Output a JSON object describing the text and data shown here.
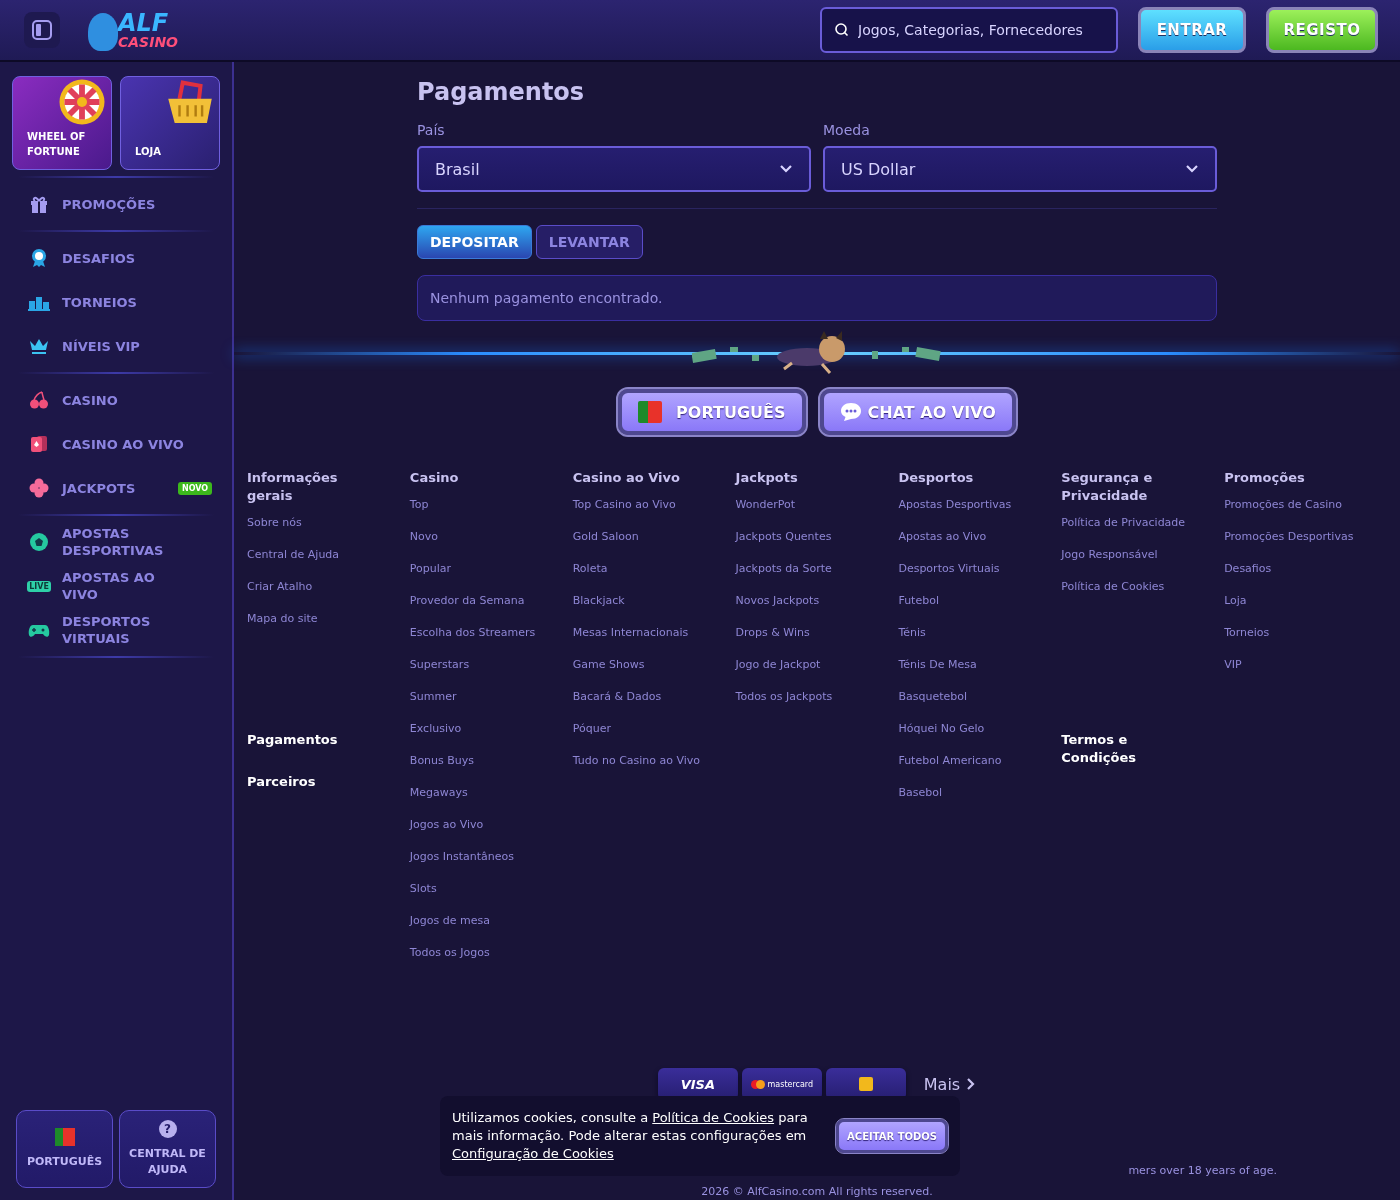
{
  "header": {
    "logo": {
      "line1": "ALF",
      "line2": "CASINO"
    },
    "search": {
      "placeholder": "Jogos, Categorias, Fornecedores"
    },
    "login_button": "ENTRAR",
    "register_button": "REGISTO"
  },
  "sidebar": {
    "promo_cards": [
      {
        "kind": "wheel",
        "label": "WHEEL OF FORTUNE"
      },
      {
        "kind": "basket",
        "label": "LOJA"
      }
    ],
    "groups": [
      [
        {
          "kind": "gift",
          "label": "PROMOÇÕES"
        }
      ],
      [
        {
          "kind": "medal",
          "label": "DESAFIOS"
        },
        {
          "kind": "podium",
          "label": "TORNEIOS"
        },
        {
          "kind": "crown",
          "label": "NÍVEIS VIP"
        }
      ],
      [
        {
          "kind": "cherry",
          "label": "CASINO"
        },
        {
          "kind": "cards",
          "label": "CASINO AO VIVO"
        },
        {
          "kind": "clover",
          "label": "JACKPOTS",
          "badge": "NOVO"
        }
      ],
      [
        {
          "kind": "ball",
          "label": "APOSTAS DESPORTIVAS"
        },
        {
          "kind": "live",
          "label": "APOSTAS AO VIVO",
          "icon_text": "LIVE"
        },
        {
          "kind": "gamepad",
          "label": "DESPORTOS VIRTUAIS"
        }
      ]
    ],
    "bottom_buttons": [
      {
        "kind": "flag",
        "label": "PORTUGUÊS"
      },
      {
        "kind": "help",
        "label": "CENTRAL DE AJUDA",
        "icon_text": "?"
      }
    ]
  },
  "main": {
    "title": "Pagamentos",
    "fields": [
      {
        "label": "País",
        "value": "Brasil"
      },
      {
        "label": "Moeda",
        "value": "US Dollar"
      }
    ],
    "tabs": [
      {
        "label": "DEPOSITAR",
        "selected": true
      },
      {
        "label": "LEVANTAR",
        "selected": false
      }
    ],
    "empty_message": "Nenhum pagamento encontrado."
  },
  "footer": {
    "language_button": "PORTUGUÊS",
    "chat_button": "CHAT AO VIVO",
    "columns": [
      {
        "title": "Informações gerais",
        "links": [
          "Sobre nós",
          "Central de Ajuda",
          "Criar Atalho",
          "Mapa do site"
        ],
        "extra_headings": [
          "Pagamentos",
          "Parceiros"
        ]
      },
      {
        "title": "Casino",
        "links": [
          "Top",
          "Novo",
          "Popular",
          "Provedor da Semana",
          "Escolha dos Streamers",
          "Superstars",
          "Summer",
          "Exclusivo",
          "Bonus Buys",
          "Megaways",
          "Jogos ao Vivo",
          "Jogos Instantâneos",
          "Slots",
          "Jogos de mesa",
          "Todos os Jogos"
        ]
      },
      {
        "title": "Casino ao Vivo",
        "links": [
          "Top Casino ao Vivo",
          "Gold Saloon",
          "Roleta",
          "Blackjack",
          "Mesas Internacionais",
          "Game Shows",
          "Bacará & Dados",
          "Póquer",
          "Tudo no Casino ao Vivo"
        ]
      },
      {
        "title": "Jackpots",
        "links": [
          "WonderPot",
          "Jackpots Quentes",
          "Jackpots da Sorte",
          "Novos Jackpots",
          "Drops & Wins",
          "Jogo de Jackpot",
          "Todos os Jackpots"
        ]
      },
      {
        "title": "Desportos",
        "links": [
          "Apostas Desportivas",
          "Apostas ao Vivo",
          "Desportos Virtuais",
          "Futebol",
          "Ténis",
          "Ténis De Mesa",
          "Basquetebol",
          "Hóquei No Gelo",
          "Futebol Americano",
          "Basebol"
        ]
      },
      {
        "title": "Segurança e Privacidade",
        "links": [
          "Política de Privacidade",
          "Jogo Responsável",
          "Política de Cookies"
        ],
        "extra_headings": [
          "Termos e Condições"
        ]
      },
      {
        "title": "Promoções",
        "links": [
          "Promoções de Casino",
          "Promoções Desportivas",
          "Desafios",
          "Loja",
          "Torneios",
          "VIP"
        ]
      }
    ],
    "payments": [
      {
        "kind": "visa",
        "label": "VISA"
      },
      {
        "kind": "mastercard",
        "label": "mastercard"
      },
      {
        "kind": "wallet"
      }
    ],
    "more_link": "Mais",
    "age_notice": "mers over 18 years of age.",
    "copyright": "2026 © AlfCasino.com All rights reserved."
  },
  "cookie_banner": {
    "text_before": "Utilizamos cookies, consulte a ",
    "link1": "Política de Cookies",
    "text_middle": " para mais informação. Pode alterar estas configurações em ",
    "link2": "Configuração de Cookies",
    "accept_button": "ACEITAR TODOS"
  }
}
